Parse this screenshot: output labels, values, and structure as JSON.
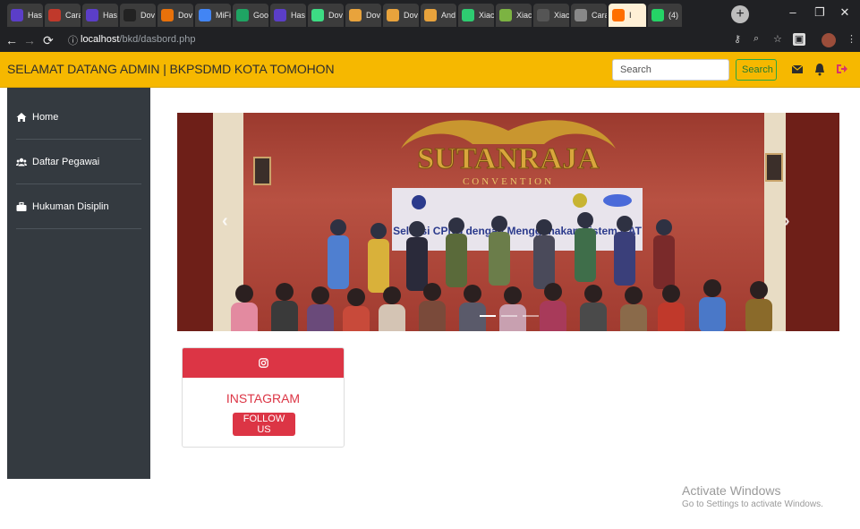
{
  "browser": {
    "tabs": [
      {
        "title": "Has",
        "color": "#5b3ec8"
      },
      {
        "title": "Cara",
        "color": "#c0392b"
      },
      {
        "title": "Has",
        "color": "#5b3ec8"
      },
      {
        "title": "Dov",
        "color": "#222222"
      },
      {
        "title": "Dov",
        "color": "#e8710a"
      },
      {
        "title": "MiFi",
        "color": "#4285f4"
      },
      {
        "title": "Goo",
        "color": "#1fa463"
      },
      {
        "title": "Has",
        "color": "#5b3ec8"
      },
      {
        "title": "Dov",
        "color": "#3ddc84"
      },
      {
        "title": "Dov",
        "color": "#e8a33c"
      },
      {
        "title": "Dov",
        "color": "#e8a33c"
      },
      {
        "title": "And",
        "color": "#e8a33c"
      },
      {
        "title": "Xiac",
        "color": "#2ecc71"
      },
      {
        "title": "Xiac",
        "color": "#7cb342"
      },
      {
        "title": "Xiac",
        "color": "#555555"
      },
      {
        "title": "Cara",
        "color": "#888888"
      },
      {
        "title": "I",
        "color": "#ff6f00",
        "active": true
      },
      {
        "title": "(4)",
        "color": "#25d366"
      }
    ],
    "url_host": "localhost",
    "url_path": "/bkd/dasbord.php"
  },
  "header": {
    "title": "SELAMAT DATANG ADMIN | BKPSDMD KOTA TOMOHON",
    "search_placeholder": "Search",
    "search_button": "Search"
  },
  "sidebar": {
    "items": [
      {
        "label": "Home",
        "icon": "home-icon"
      },
      {
        "label": "Daftar Pegawai",
        "icon": "users-icon"
      },
      {
        "label": "Hukuman Disiplin",
        "icon": "briefcase-icon"
      }
    ]
  },
  "carousel": {
    "banner_text": "SUTANRAJA",
    "banner_sub": "CONVENTION",
    "slide_text": "Seleksi CPNS dengan Menggunakan Sistem CAT",
    "prev_icon": "chevron-left-icon",
    "next_icon": "chevron-right-icon"
  },
  "instagram": {
    "title": "INSTAGRAM",
    "button": "FOLLOW US",
    "icon": "instagram-icon"
  },
  "watermark": {
    "line1": "Activate Windows",
    "line2": "Go to Settings to activate Windows."
  },
  "colors": {
    "header": "#f6b800",
    "sidebar": "#343a40",
    "accent_red": "#dc3545",
    "search_button_border": "#28a745"
  }
}
